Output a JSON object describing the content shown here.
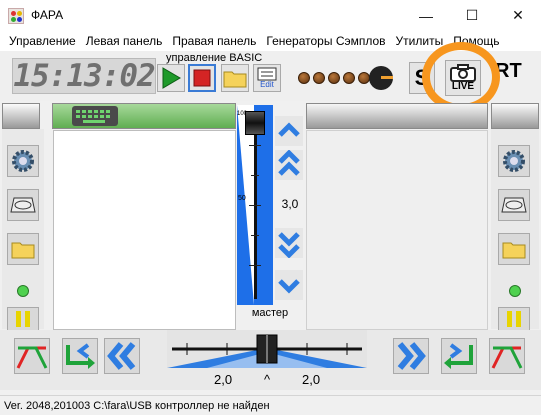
{
  "window": {
    "title": "ФАРА",
    "minimize_glyph": "—",
    "maximize_glyph": "☐",
    "close_glyph": "✕"
  },
  "menu": [
    "Управление",
    "Левая панель",
    "Правая панель",
    "Генераторы Сэмплов",
    "Утилиты",
    "Помощь"
  ],
  "toolbar": {
    "clock": "15:13:02",
    "basic_label": "управление  BASIC",
    "edit_label": "Edit",
    "live_label": "LIVE",
    "partial_glyph_1": "S",
    "partial_glyph_2": "RT"
  },
  "master": {
    "value": "3,0",
    "label": "мастер",
    "scale_top": "100",
    "scale_mid": "50"
  },
  "crossfader": {
    "left_value": "2,0",
    "center": "^",
    "right_value": "2,0"
  },
  "status": "Ver. 2048,201003 C:\\fara\\USB контроллер не найден",
  "colors": {
    "accent_blue": "#1e6fe8",
    "highlight": "#f7961e",
    "green_header": "#79c06a"
  }
}
